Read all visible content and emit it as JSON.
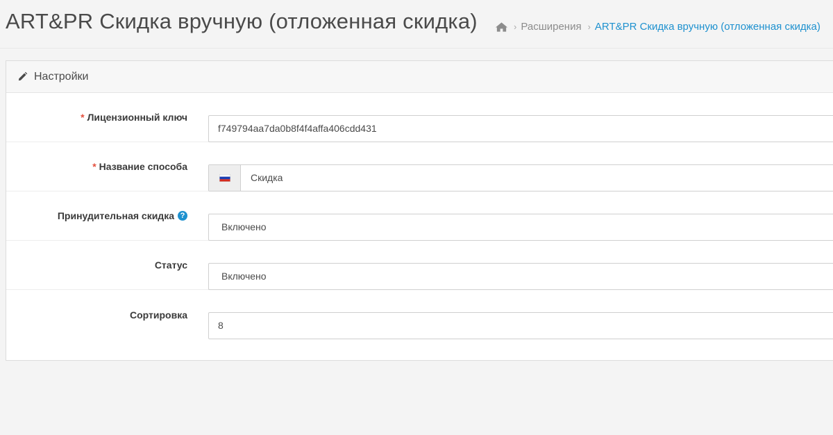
{
  "header": {
    "title": "ART&PR Скидка вручную (отложенная скидка)",
    "breadcrumb": {
      "home_icon": "home-icon",
      "items": [
        "Расширения",
        "ART&PR Скидка вручную (отложенная скидка)"
      ]
    }
  },
  "panel": {
    "icon": "pencil-icon",
    "title": "Настройки"
  },
  "form": {
    "license_key": {
      "label": "Лицензионный ключ",
      "required_mark": "*",
      "value": "f749794aa7da0b8f4f4affa406cdd431"
    },
    "method_name": {
      "label": "Название способа",
      "required_mark": "*",
      "language_flag": "ru-flag-icon",
      "value": "Скидка"
    },
    "forced_discount": {
      "label": "Принудительная скидка",
      "help_icon": "?",
      "value": "Включено"
    },
    "status": {
      "label": "Статус",
      "value": "Включено"
    },
    "sort_order": {
      "label": "Сортировка",
      "value": "8"
    }
  },
  "colors": {
    "accent": "#1e91cf",
    "required": "#e3503e",
    "background": "#f4f4f4"
  }
}
